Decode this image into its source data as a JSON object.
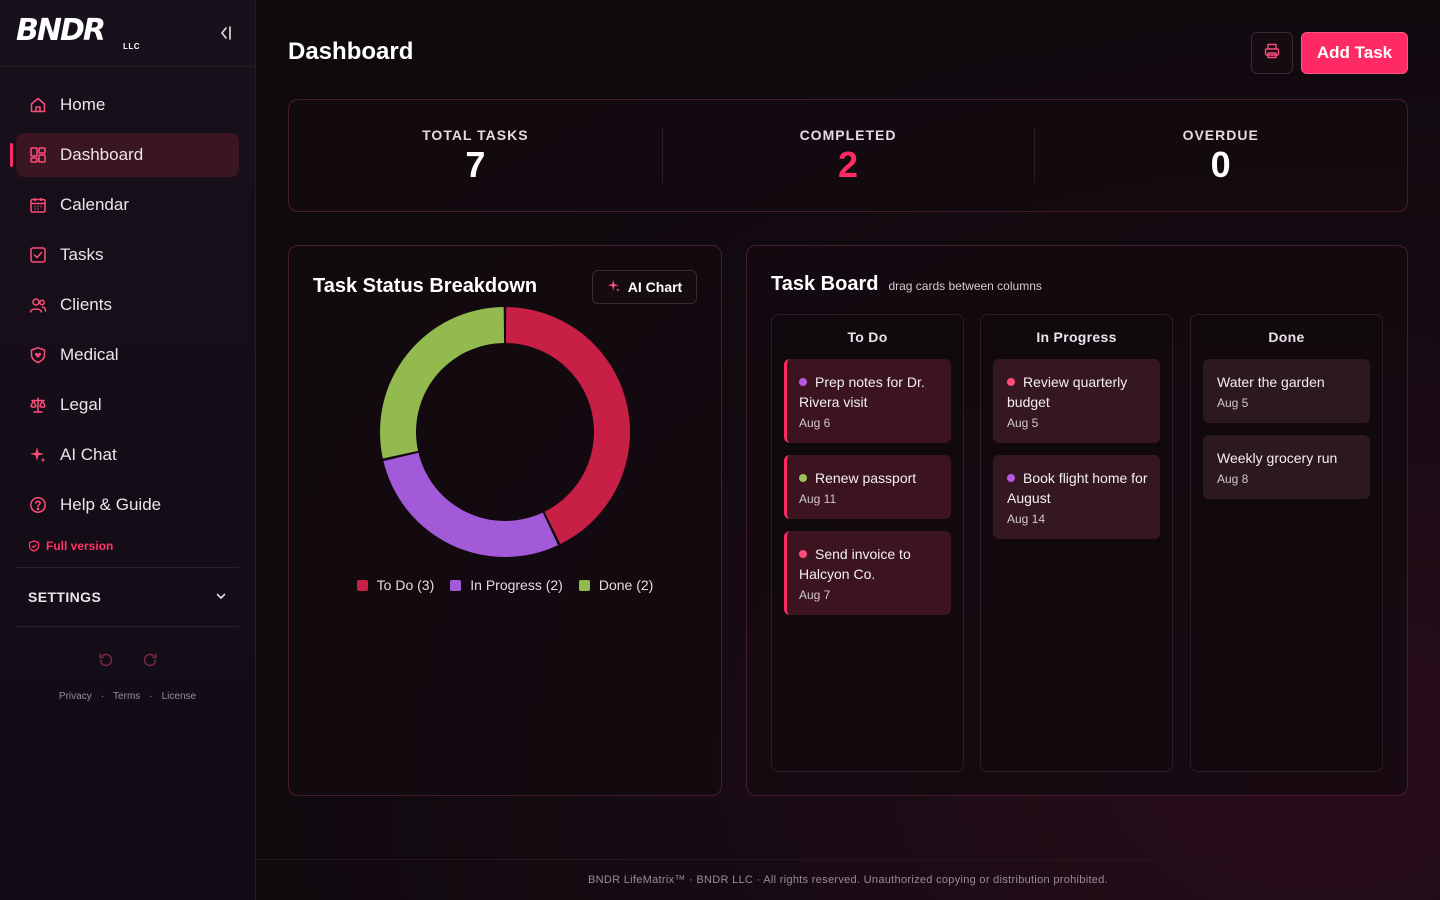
{
  "brand": {
    "logo_main": "BNDR",
    "logo_sub": "LLC"
  },
  "nav": {
    "items": [
      {
        "label": "Home",
        "icon": "home-icon"
      },
      {
        "label": "Dashboard",
        "icon": "dashboard-icon",
        "active": true
      },
      {
        "label": "Calendar",
        "icon": "calendar-icon"
      },
      {
        "label": "Tasks",
        "icon": "checkbox-icon"
      },
      {
        "label": "Clients",
        "icon": "users-icon"
      },
      {
        "label": "Medical",
        "icon": "heart-shield-icon"
      },
      {
        "label": "Legal",
        "icon": "scales-icon"
      },
      {
        "label": "AI Chat",
        "icon": "sparkle-icon"
      },
      {
        "label": "Help & Guide",
        "icon": "help-icon"
      }
    ],
    "full_version": "Full version"
  },
  "settings": {
    "label": "SETTINGS"
  },
  "legal": {
    "privacy": "Privacy",
    "terms": "Terms",
    "license": "License",
    "sep": "·"
  },
  "header": {
    "title": "Dashboard",
    "add_task": "Add Task"
  },
  "stats": [
    {
      "label": "TOTAL TASKS",
      "value": "7"
    },
    {
      "label": "COMPLETED",
      "value": "2"
    },
    {
      "label": "OVERDUE",
      "value": "0"
    }
  ],
  "chart_card": {
    "title": "Task Status Breakdown",
    "ai_button": "AI Chart"
  },
  "chart_data": {
    "type": "pie",
    "donut": true,
    "categories": [
      "To Do",
      "In Progress",
      "Done"
    ],
    "values": [
      3,
      2,
      2
    ],
    "colors": [
      "#c71f45",
      "#a25ad9",
      "#93ba4e"
    ],
    "legend": [
      "To Do (3)",
      "In Progress (2)",
      "Done (2)"
    ],
    "legend_position": "bottom"
  },
  "board": {
    "title": "Task Board",
    "subtitle": "drag cards between columns",
    "columns": [
      {
        "name": "To Do",
        "cards": [
          {
            "title": "Prep notes for Dr. Rivera visit",
            "date": "Aug 6",
            "dot": "#b75ae0"
          },
          {
            "title": "Renew passport",
            "date": "Aug 11",
            "dot": "#9bc254"
          },
          {
            "title": "Send invoice to Halcyon Co.",
            "date": "Aug 7",
            "dot": "#ff4d7a"
          }
        ]
      },
      {
        "name": "In Progress",
        "cards": [
          {
            "title": "Review quarterly budget",
            "date": "Aug 5",
            "dot": "#ff4d7a"
          },
          {
            "title": "Book flight home for August",
            "date": "Aug 14",
            "dot": "#b75ae0"
          }
        ]
      },
      {
        "name": "Done",
        "cards": [
          {
            "title": "Water the garden",
            "date": "Aug 5"
          },
          {
            "title": "Weekly grocery run",
            "date": "Aug 8"
          }
        ]
      }
    ]
  },
  "footer": {
    "text": "BNDR LifeMatrix™ · BNDR LLC · All rights reserved. Unauthorized copying or distribution prohibited."
  },
  "colors": {
    "accent": "#ff2a63",
    "border": "#4a1d2c"
  }
}
